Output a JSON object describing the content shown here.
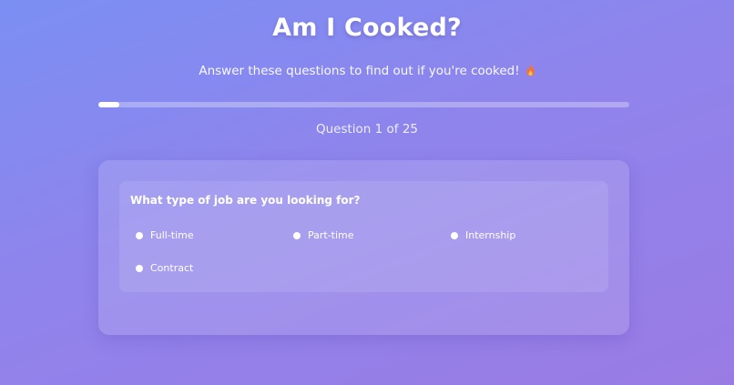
{
  "header": {
    "title": "Am I Cooked?",
    "subtitle": "Answer these questions to find out if you're cooked!",
    "subtitle_icon": "flame-icon"
  },
  "progress": {
    "current": 1,
    "total": 25,
    "fraction": 0.04,
    "label": "Question 1 of 25"
  },
  "question": {
    "text": "What type of job are you looking for?",
    "options": [
      {
        "label": "Full-time"
      },
      {
        "label": "Part-time"
      },
      {
        "label": "Internship"
      },
      {
        "label": "Contract"
      }
    ]
  },
  "colors": {
    "background_start": "#7b8ff3",
    "background_end": "#9a7be4",
    "text": "#ffffff",
    "flame": "#f2733a"
  }
}
